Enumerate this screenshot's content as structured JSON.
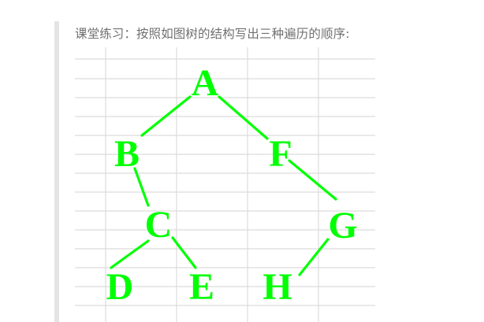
{
  "exercise": {
    "caption": "课堂练习：按照如图树的结构写出三种遍历的顺序:"
  },
  "tree": {
    "line_color": "#00ff00",
    "grid_color": "#dcdcdc",
    "nodes": {
      "a": "A",
      "b": "B",
      "f": "F",
      "c": "C",
      "g": "G",
      "d": "D",
      "e": "E",
      "h": "H"
    }
  }
}
